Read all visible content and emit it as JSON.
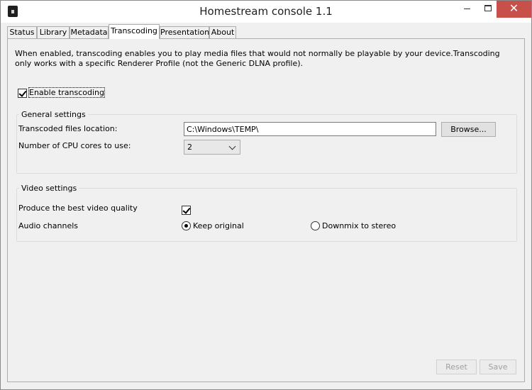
{
  "window": {
    "title": "Homestream console 1.1",
    "minimize_icon": "minimize-icon",
    "maximize_icon": "maximize-icon",
    "close_icon": "close-icon",
    "close_glyph": "✕",
    "close_color": "#c7504a"
  },
  "tabs": [
    {
      "label": "Status",
      "active": false
    },
    {
      "label": "Library",
      "active": false
    },
    {
      "label": "Metadata",
      "active": false
    },
    {
      "label": "Transcoding",
      "active": true
    },
    {
      "label": "Presentation",
      "active": false
    },
    {
      "label": "About",
      "active": false
    }
  ],
  "transcoding": {
    "description": "When enabled, transcoding enables you to play media files that would not normally be playable by your device.Transcoding only works with a specific Renderer Profile (not the Generic DLNA profile).",
    "enable_label": "Enable transcoding",
    "enable_checked": true
  },
  "general": {
    "title": "General settings",
    "location_label": "Transcoded files location:",
    "location_value": "C:\\Windows\\TEMP\\",
    "browse_label": "Browse...",
    "cpu_label": "Number of CPU cores to use:",
    "cpu_value": "2"
  },
  "video": {
    "title": "Video settings",
    "quality_label": "Produce the best video quality",
    "quality_checked": true,
    "audio_label": "Audio channels",
    "audio_options": [
      {
        "label": "Keep original",
        "selected": true
      },
      {
        "label": "Downmix to stereo",
        "selected": false
      }
    ]
  },
  "footer": {
    "reset_label": "Reset",
    "save_label": "Save"
  }
}
